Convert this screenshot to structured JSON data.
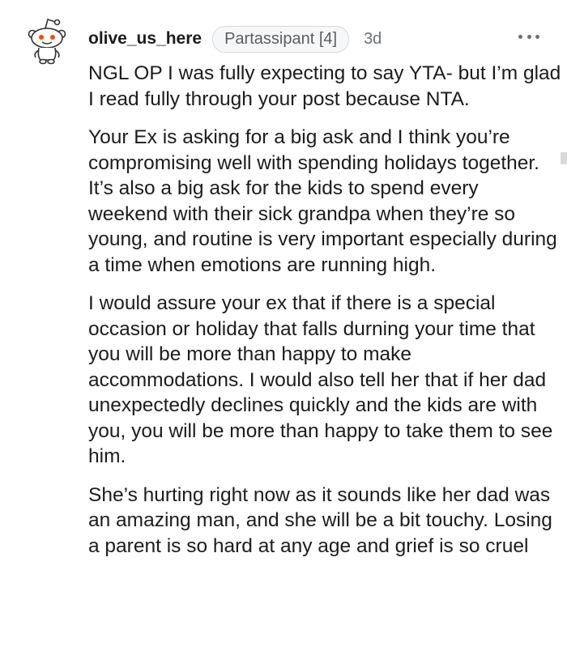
{
  "comment": {
    "username": "olive_us_here",
    "flair": "Partassipant [4]",
    "age": "3d",
    "avatar_icon": "snoo-avatar-icon",
    "more_icon": "more-options-icon",
    "paragraphs": [
      "NGL OP I was fully expecting to say YTA- but I’m glad I read fully through your post because NTA.",
      "Your Ex is asking for a big ask and I think you’re compromising well with spending holidays together. It’s also a big ask for the kids to spend every weekend with their sick grandpa when they’re so young, and routine is very important especially during a time when emotions are running high.",
      "I would assure your ex that if there is a special occasion or holiday that falls durning your time that you will be more than happy to make accommodations. I would also tell her that if her dad unexpectedly declines quickly and the kids are with you, you will be more than happy to take them to see him.",
      "She’s hurting right now as it sounds like her dad was an amazing man, and she will be a bit touchy. Losing a parent is so hard at any age and grief is so cruel"
    ]
  },
  "colors": {
    "text": "#1c1c1c",
    "meta": "#6e7175",
    "flair_bg": "#f6f7f8",
    "snoo_eye": "#ff4500"
  }
}
